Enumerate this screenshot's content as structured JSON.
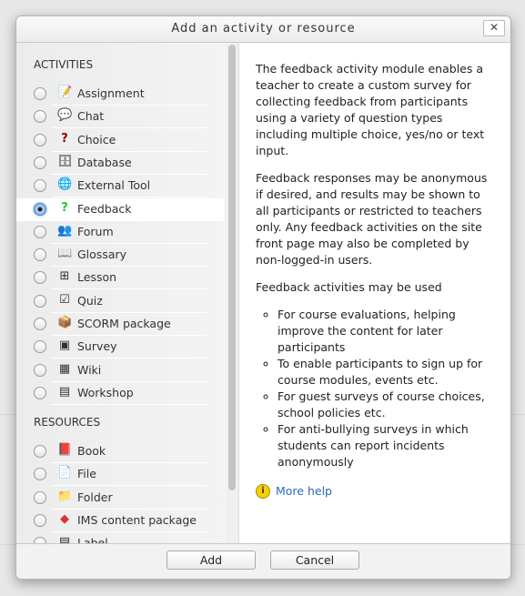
{
  "dialog": {
    "title": "Add an activity or resource",
    "close": "✕"
  },
  "activities_header": "ACTIVITIES",
  "resources_header": "RESOURCES",
  "activities": [
    {
      "label": "Assignment",
      "icon": "assignment-icon",
      "glyph": "📝"
    },
    {
      "label": "Chat",
      "icon": "chat-icon",
      "glyph": "💬"
    },
    {
      "label": "Choice",
      "icon": "choice-icon",
      "glyph": "?"
    },
    {
      "label": "Database",
      "icon": "database-icon",
      "glyph": "🗄"
    },
    {
      "label": "External Tool",
      "icon": "external-tool-icon",
      "glyph": "🌐"
    },
    {
      "label": "Feedback",
      "icon": "feedback-icon",
      "glyph": "?",
      "selected": true
    },
    {
      "label": "Forum",
      "icon": "forum-icon",
      "glyph": "👥"
    },
    {
      "label": "Glossary",
      "icon": "glossary-icon",
      "glyph": "📖"
    },
    {
      "label": "Lesson",
      "icon": "lesson-icon",
      "glyph": "⊞"
    },
    {
      "label": "Quiz",
      "icon": "quiz-icon",
      "glyph": "☑"
    },
    {
      "label": "SCORM package",
      "icon": "scorm-icon",
      "glyph": "📦"
    },
    {
      "label": "Survey",
      "icon": "survey-icon",
      "glyph": "▣"
    },
    {
      "label": "Wiki",
      "icon": "wiki-icon",
      "glyph": "▦"
    },
    {
      "label": "Workshop",
      "icon": "workshop-icon",
      "glyph": "▤"
    }
  ],
  "resources": [
    {
      "label": "Book",
      "icon": "book-icon",
      "glyph": "📕"
    },
    {
      "label": "File",
      "icon": "file-icon",
      "glyph": "📄"
    },
    {
      "label": "Folder",
      "icon": "folder-icon",
      "glyph": "📁"
    },
    {
      "label": "IMS content package",
      "icon": "ims-icon",
      "glyph": "◆"
    },
    {
      "label": "Label",
      "icon": "label-icon",
      "glyph": "▤"
    }
  ],
  "description": {
    "p1": "The feedback activity module enables a teacher to create a custom survey for collecting feedback from participants using a variety of question types including multiple choice, yes/no or text input.",
    "p2": "Feedback responses may be anonymous if desired, and results may be shown to all participants or restricted to teachers only. Any feedback activities on the site front page may also be completed by non-logged-in users.",
    "p3": "Feedback activities may be used",
    "bullets": [
      "For course evaluations, helping improve the content for later participants",
      "To enable participants to sign up for course modules, events etc.",
      "For guest surveys of course choices, school policies etc.",
      "For anti-bullying surveys in which students can report incidents anonymously"
    ],
    "more_help": "More help"
  },
  "footer": {
    "add": "Add",
    "cancel": "Cancel"
  }
}
